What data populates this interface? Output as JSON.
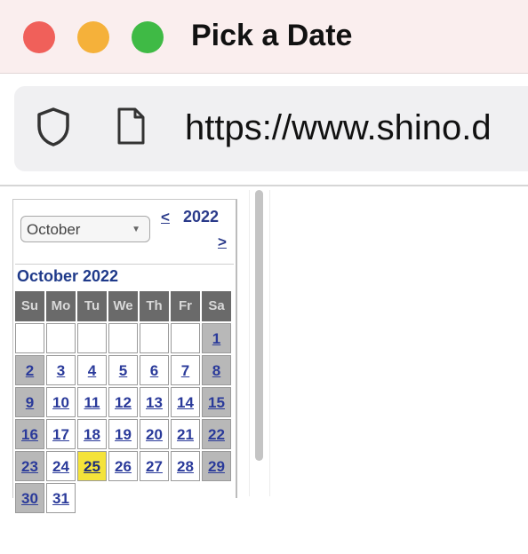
{
  "window": {
    "title": "Pick a Date"
  },
  "address_bar": {
    "url": "https://www.shino.d"
  },
  "calendar": {
    "month_select": {
      "value": "October"
    },
    "year": "2022",
    "prev_label": "<",
    "next_label": ">",
    "month_heading": "October 2022",
    "weekdays": [
      "Su",
      "Mo",
      "Tu",
      "We",
      "Th",
      "Fr",
      "Sa"
    ],
    "weeks": [
      [
        "",
        "",
        "",
        "",
        "",
        "",
        "1"
      ],
      [
        "2",
        "3",
        "4",
        "5",
        "6",
        "7",
        "8"
      ],
      [
        "9",
        "10",
        "11",
        "12",
        "13",
        "14",
        "15"
      ],
      [
        "16",
        "17",
        "18",
        "19",
        "20",
        "21",
        "22"
      ],
      [
        "23",
        "24",
        "25",
        "26",
        "27",
        "28",
        "29"
      ],
      [
        "30",
        "31"
      ]
    ],
    "today": "25",
    "colors": {
      "today_highlight": "#f4e33a",
      "header_bg": "#6a6a6a",
      "link": "#2a3a9a"
    }
  }
}
